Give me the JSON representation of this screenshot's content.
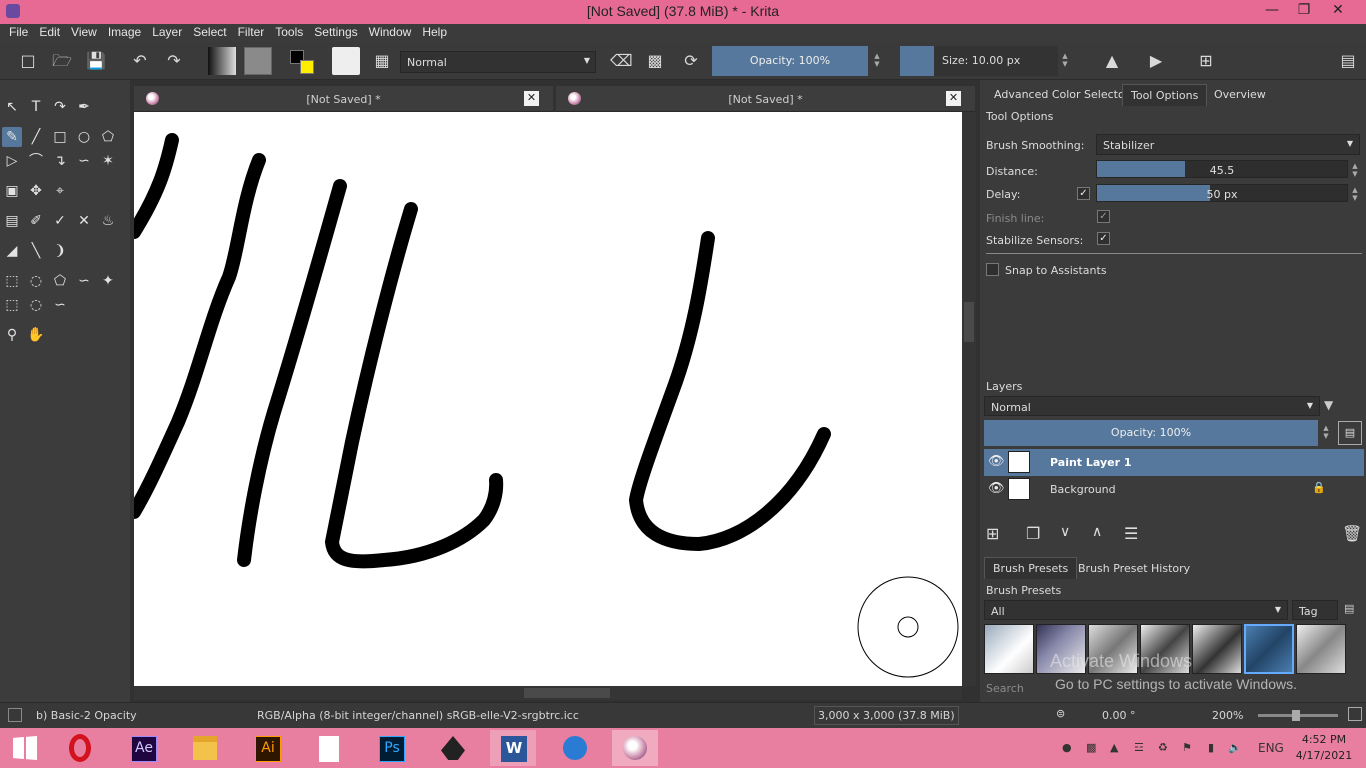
{
  "app": {
    "title": "[Not Saved]  (37.8 MiB)  * - Krita",
    "window_controls": [
      "minimize-icon",
      "restore-icon",
      "close-icon"
    ]
  },
  "menu": [
    "File",
    "Edit",
    "View",
    "Image",
    "Layer",
    "Select",
    "Filter",
    "Tools",
    "Settings",
    "Window",
    "Help"
  ],
  "toolbar": {
    "blend_mode": "Normal",
    "opacity": "Opacity: 100%",
    "size": "Size: 10.00 px",
    "icons": [
      "new-document-icon",
      "open-icon",
      "save-icon",
      "undo-icon",
      "redo-icon",
      "gradient-icon",
      "pattern-icon",
      "colors-icon",
      "brush-preset-icon",
      "workspace-icon",
      "eraser-icon",
      "alpha-lock-icon",
      "reload-preset-icon",
      "mirror-horizontal-icon",
      "mirror-vertical-icon",
      "wrap-icon",
      "choose-workspace-icon"
    ]
  },
  "documents": [
    {
      "title": "[Not Saved]  *"
    },
    {
      "title": "[Not Saved]  *"
    }
  ],
  "tool_options": {
    "tabs": [
      "Advanced Color Selector",
      "Tool Options",
      "Overview"
    ],
    "active_tab": "Tool Options",
    "header": "Tool Options",
    "brush_smoothing_label": "Brush Smoothing:",
    "brush_smoothing_value": "Stabilizer",
    "distance_label": "Distance:",
    "distance_value": "45.5",
    "distance_fraction": 0.35,
    "delay_label": "Delay:",
    "delay_value": "50 px",
    "delay_fraction": 0.45,
    "delay_checked": true,
    "finish_line_label": "Finish line:",
    "finish_line_checked": true,
    "stabilize_sensors_label": "Stabilize Sensors:",
    "stabilize_sensors_checked": true,
    "snap_label": "Snap to Assistants",
    "snap_checked": false
  },
  "layers": {
    "header": "Layers",
    "blend_mode": "Normal",
    "opacity": "Opacity:  100%",
    "items": [
      {
        "name": "Paint Layer 1",
        "selected": true,
        "visible": true
      },
      {
        "name": "Background",
        "selected": false,
        "visible": true,
        "locked": true
      }
    ]
  },
  "brush_presets": {
    "tabs": [
      "Brush Presets",
      "Brush Preset History"
    ],
    "header": "Brush Presets",
    "filter": "All",
    "tag_label": "Tag",
    "search_placeholder": "Search"
  },
  "watermark": {
    "line1": "Activate Windows",
    "line2": "Go to PC settings to activate Windows."
  },
  "status": {
    "preset": "b) Basic-2 Opacity",
    "color_space": "RGB/Alpha (8-bit integer/channel)  sRGB-elle-V2-srgbtrc.icc",
    "dimensions": "3,000 x 3,000 (37.8 MiB)",
    "rotation": "0.00 °",
    "zoom": "200%"
  },
  "taskbar": {
    "apps": [
      "windows-start-icon",
      "opera-icon",
      "after-effects-icon",
      "file-explorer-icon",
      "illustrator-icon",
      "document-icon",
      "photoshop-icon",
      "inkscape-icon",
      "word-icon",
      "app-icon",
      "krita-icon"
    ],
    "app_labels": {
      "ae": "Ae",
      "ai": "Ai",
      "ps": "Ps",
      "w": "W"
    },
    "lang": "ENG",
    "time": "4:52 PM",
    "date": "4/17/2021"
  }
}
